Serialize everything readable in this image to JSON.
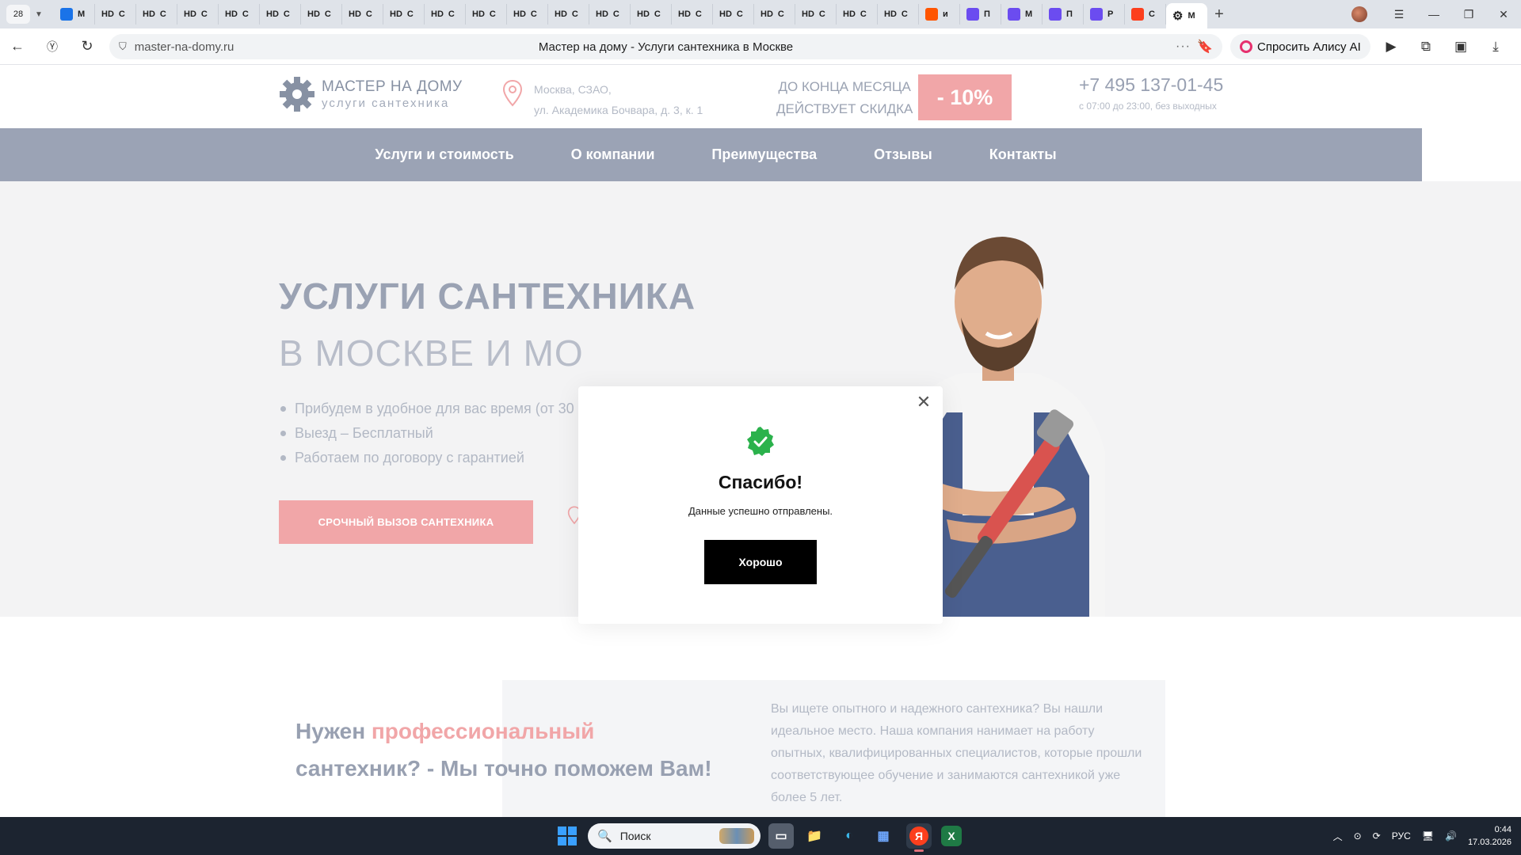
{
  "browser": {
    "tab_count": "28",
    "tabs": [
      {
        "label": "М",
        "icon": "pause-app-icon",
        "color": "#1a73e8"
      },
      {
        "label": "С",
        "prefix": "HD"
      },
      {
        "label": "С",
        "prefix": "HD"
      },
      {
        "label": "С",
        "prefix": "HD"
      },
      {
        "label": "С",
        "prefix": "HD"
      },
      {
        "label": "С",
        "prefix": "HD"
      },
      {
        "label": "С",
        "prefix": "HD"
      },
      {
        "label": "С",
        "prefix": "HD"
      },
      {
        "label": "С",
        "prefix": "HD"
      },
      {
        "label": "С",
        "prefix": "HD"
      },
      {
        "label": "С",
        "prefix": "HD"
      },
      {
        "label": "С",
        "prefix": "HD"
      },
      {
        "label": "С",
        "prefix": "HD"
      },
      {
        "label": "С",
        "prefix": "HD"
      },
      {
        "label": "С",
        "prefix": "HD"
      },
      {
        "label": "С",
        "prefix": "HD"
      },
      {
        "label": "С",
        "prefix": "HD"
      },
      {
        "label": "С",
        "prefix": "HD"
      },
      {
        "label": "С",
        "prefix": "HD"
      },
      {
        "label": "С",
        "prefix": "HD"
      },
      {
        "label": "С",
        "prefix": "HD"
      },
      {
        "label": "и",
        "icon": "kinopoisk-icon",
        "color": "#ff5500"
      },
      {
        "label": "П",
        "icon": "u-app-icon",
        "color": "#6b4cf0"
      },
      {
        "label": "М",
        "icon": "u-app-icon",
        "color": "#6b4cf0"
      },
      {
        "label": "П",
        "icon": "u-app-icon",
        "color": "#6b4cf0"
      },
      {
        "label": "Р",
        "icon": "u-app-icon",
        "color": "#6b4cf0"
      },
      {
        "label": "С",
        "icon": "yandex-icon",
        "color": "#fc3f1d"
      }
    ],
    "active_tab_label": "М",
    "url": "master-na-domy.ru",
    "page_title": "Мастер на дому - Услуги сантехника в Москве",
    "alice_label": "Спросить Алису AI"
  },
  "site": {
    "logo_line1": "МАСТЕР НА ДОМУ",
    "logo_line2": "услуги сантехника",
    "address_line1": "Москва, СЗАО,",
    "address_line2": "ул. Академика Бочвара, д. 3, к. 1",
    "promo_line1": "ДО КОНЦА МЕСЯЦА",
    "promo_line2": "ДЕЙСТВУЕТ СКИДКА",
    "promo_badge": "- 10%",
    "phone": "+7 495 137-01-45",
    "hours": "с 07:00 до 23:00, без выходных",
    "nav": [
      "Услуги и стоимость",
      "О компании",
      "Преимущества",
      "Отзывы",
      "Контакты"
    ],
    "hero_title": "УСЛУГИ САНТЕХНИКА",
    "hero_subtitle": "В МОСКВЕ И МО",
    "hero_points": [
      "Прибудем в удобное для вас время (от 30 м",
      "Выезд – Бесплатный",
      "Работаем по договору с гарантией"
    ],
    "cta_label": "СРОЧНЫЙ ВЫЗОВ САНТЕХНИКА",
    "about_title_pre": "Нужен ",
    "about_title_accent": "профессиональный",
    "about_title_post": "сантехник? - Мы точно поможем Вам!",
    "about_text": "Вы ищете опытного и надежного сантехника? Вы нашли идеальное место. Наша компания нанимает на работу опытных, квалифицированных специалистов, которые прошли соответствующее обучение и занимаются сантехникой уже более 5 лет."
  },
  "modal": {
    "title": "Спасибо!",
    "text": "Данные успешно отправлены.",
    "button": "Хорошо"
  },
  "taskbar": {
    "search_placeholder": "Поиск",
    "lang": "РУС",
    "time": "0:44",
    "date": "17.03.2026"
  },
  "colors": {
    "accent_pink": "#f1a6a8",
    "nav_bg": "#9ba3b5",
    "success_green": "#2bb24c"
  }
}
